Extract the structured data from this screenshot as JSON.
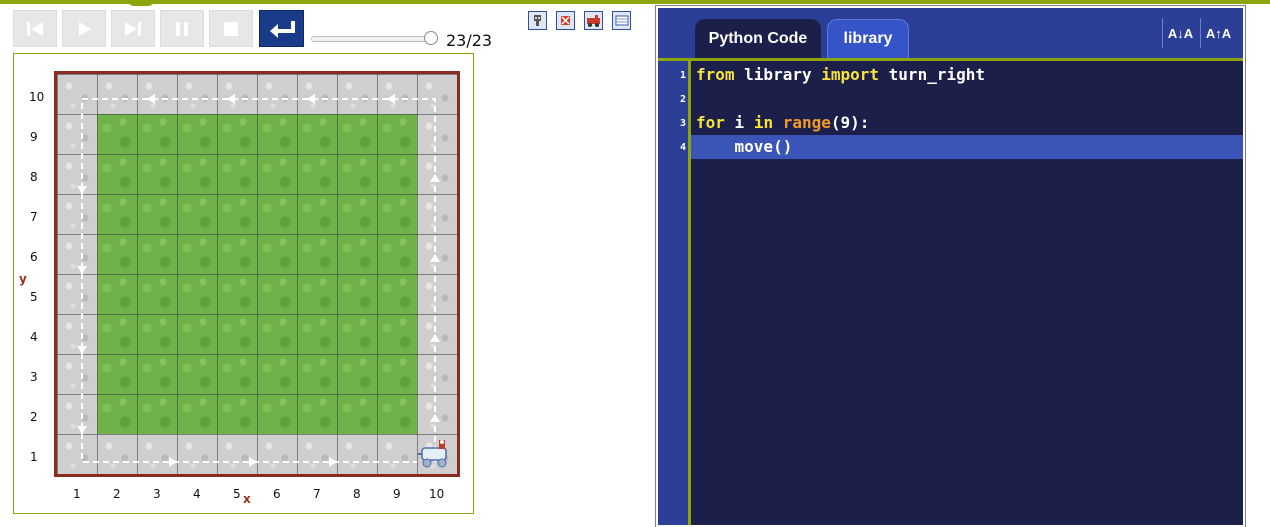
{
  "app": {
    "controls": {
      "icons": [
        "rewind-icon",
        "play-icon",
        "step-forward-icon",
        "pause-icon",
        "stop-icon",
        "return-icon"
      ],
      "step_counter": "23/23",
      "slider_value": 1.0
    },
    "world_tools": [
      "robot-tool-icon",
      "clear-world-icon",
      "delete-robot-icon",
      "edit-world-icon"
    ]
  },
  "world": {
    "x_axis_label": "x",
    "y_axis_label": "y",
    "x_ticks": [
      "1",
      "2",
      "3",
      "4",
      "5",
      "6",
      "7",
      "8",
      "9",
      "10"
    ],
    "y_ticks": [
      "10",
      "9",
      "8",
      "7",
      "6",
      "5",
      "4",
      "3",
      "2",
      "1"
    ],
    "colors": {
      "frame": "#8b2c22",
      "grass": "#6fb24a",
      "path": "#cfcfcf",
      "trail": "#ffffff"
    }
  },
  "editor": {
    "tabs": [
      {
        "label": "Python Code",
        "active": true
      },
      {
        "label": "library",
        "active": false
      }
    ],
    "font_buttons": [
      "A↓A",
      "A↑A"
    ],
    "line_numbers": [
      "1",
      "2",
      "3",
      "4"
    ],
    "highlighted_line": 4,
    "code": {
      "line1": {
        "kw1": "from",
        "t1": " library ",
        "kw2": "import",
        "t2": " turn_right"
      },
      "line3": {
        "kw1": "for",
        "t1": " i ",
        "kw2": "in",
        "t2": " ",
        "bi": "range",
        "t3": "(9):"
      },
      "line4": {
        "t1": "    move()"
      }
    },
    "colors": {
      "background": "#1b1f4a",
      "header": "#2b3f96",
      "accent": "#8da40d",
      "keyword": "#f7e43a",
      "builtin": "#f09a2a"
    }
  }
}
